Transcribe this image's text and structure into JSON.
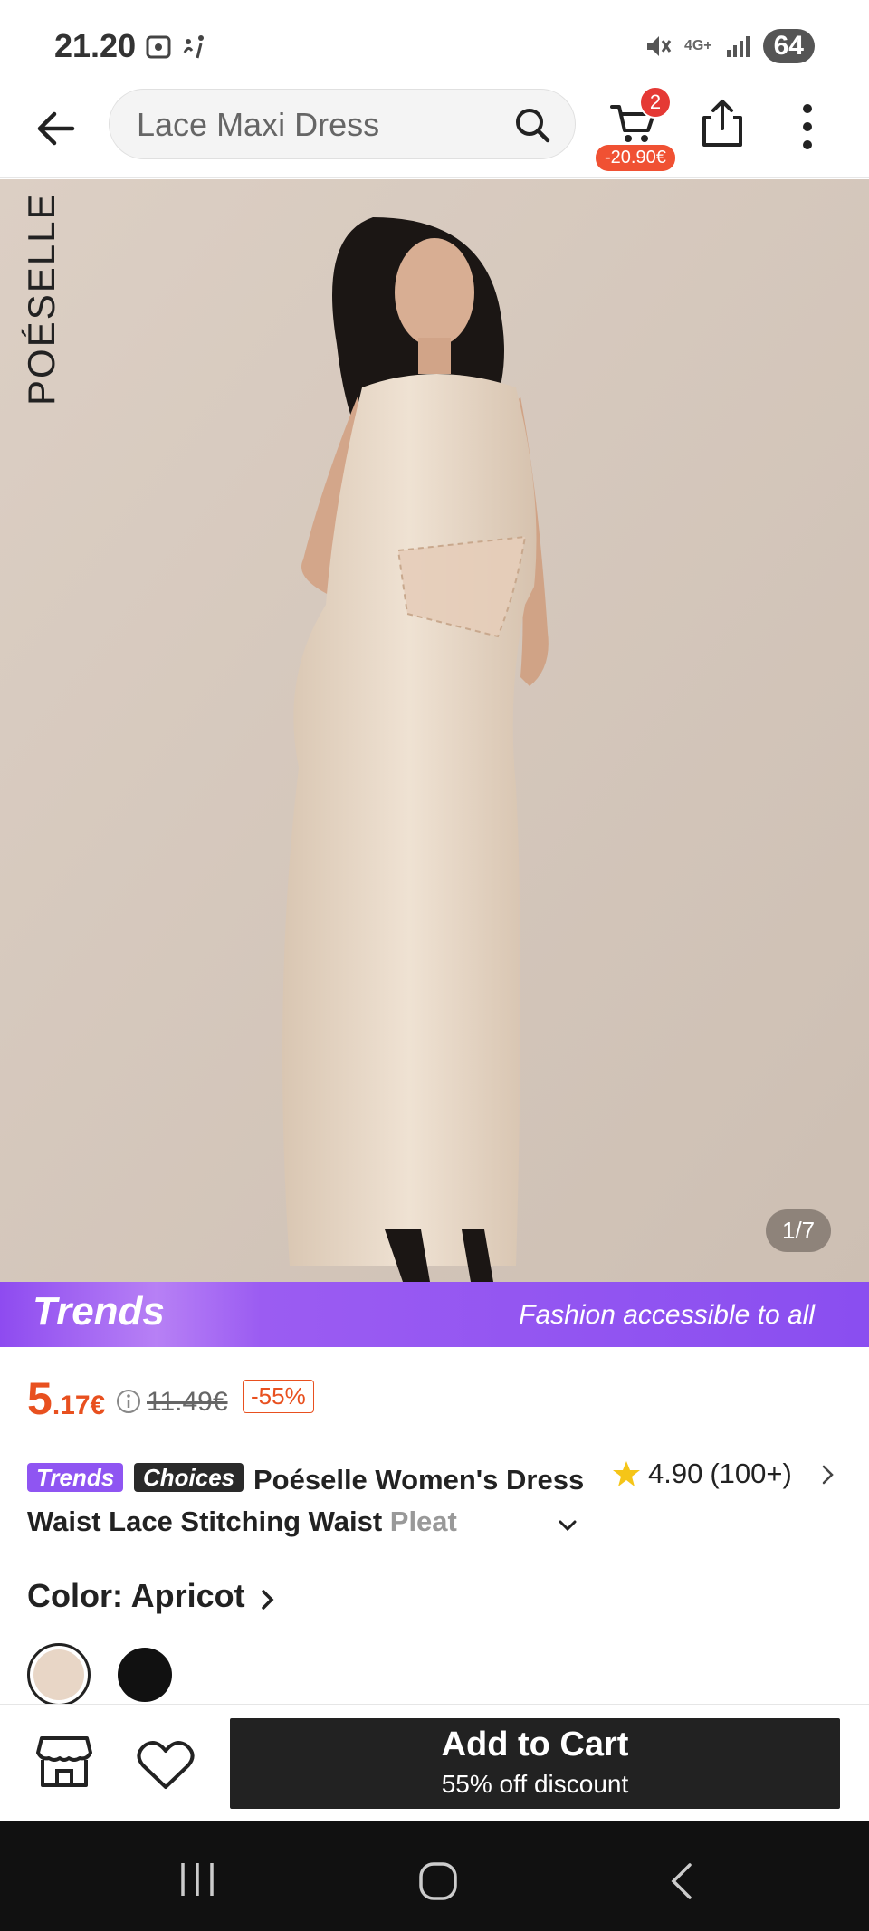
{
  "status_bar": {
    "time": "21.20",
    "network": "4G+",
    "battery": "64"
  },
  "header": {
    "search_text": "Lace Maxi Dress",
    "cart_count": "2",
    "cart_discount": "-20.90€"
  },
  "gallery": {
    "brand_watermark": "POÉSELLE",
    "counter": "1/7"
  },
  "banner": {
    "logo": "Trends",
    "tagline": "Fashion accessible to all"
  },
  "price": {
    "integer": "5",
    "decimal": ".17€",
    "original": "11.49€",
    "discount": "-55%"
  },
  "product": {
    "tag_trends": "Trends",
    "tag_choices": "Choices",
    "title_main": "Poéselle Women's Dress Waist Lace Stitching Waist ",
    "title_faded": "Pleat",
    "rating_value": "4.90",
    "rating_count": "(100+)"
  },
  "color": {
    "label": "Color: Apricot",
    "options": [
      {
        "name": "Apricot",
        "hex": "#e8d6c6",
        "selected": true
      },
      {
        "name": "Black",
        "hex": "#111111",
        "selected": false
      }
    ]
  },
  "actions": {
    "add_to_cart": "Add to Cart",
    "add_to_cart_sub": "55% off discount"
  },
  "colors": {
    "accent_orange": "#e8501f",
    "trends_purple": "#8f55f2",
    "dark_button": "#222222"
  }
}
